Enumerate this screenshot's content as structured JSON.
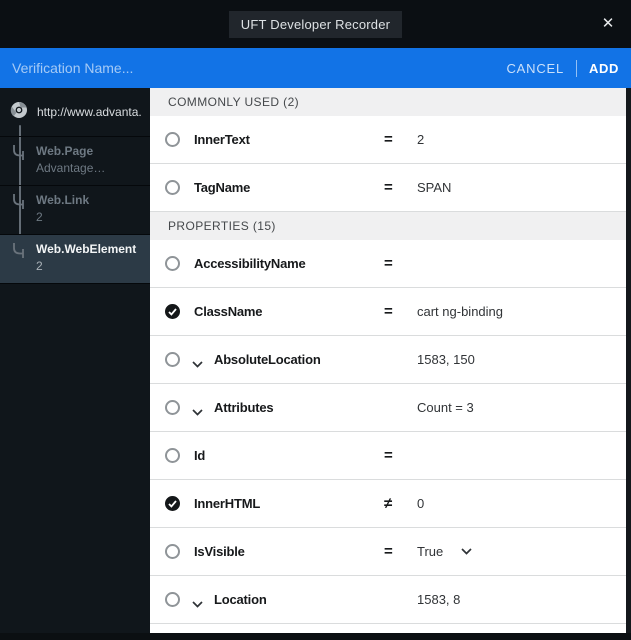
{
  "titlebar": {
    "title": "UFT Developer Recorder",
    "close_glyph": "✕"
  },
  "verification_bar": {
    "placeholder": "Verification Name...",
    "cancel_label": "CANCEL",
    "add_label": "ADD"
  },
  "sidebar": {
    "root_url": "http://www.advanta...",
    "items": [
      {
        "label": "Web.Page",
        "sub": "Advantage…",
        "selected": false
      },
      {
        "label": "Web.Link",
        "sub": "2",
        "selected": false
      },
      {
        "label": "Web.WebElement",
        "sub": "2",
        "selected": true
      }
    ]
  },
  "main": {
    "sections": [
      {
        "header": "COMMONLY USED (2)",
        "rows": [
          {
            "name": "InnerText",
            "checked": false,
            "expandable": false,
            "operator": "=",
            "value": "2",
            "value_dropdown": false
          },
          {
            "name": "TagName",
            "checked": false,
            "expandable": false,
            "operator": "=",
            "value": "SPAN",
            "value_dropdown": false
          }
        ]
      },
      {
        "header": "PROPERTIES (15)",
        "rows": [
          {
            "name": "AccessibilityName",
            "checked": false,
            "expandable": false,
            "operator": "=",
            "value": "",
            "value_dropdown": false
          },
          {
            "name": "ClassName",
            "checked": true,
            "expandable": false,
            "operator": "=",
            "value": "cart ng-binding",
            "value_dropdown": false
          },
          {
            "name": "AbsoluteLocation",
            "checked": false,
            "expandable": true,
            "operator": "",
            "value": "1583, 150",
            "value_dropdown": false
          },
          {
            "name": "Attributes",
            "checked": false,
            "expandable": true,
            "operator": "",
            "value": "Count = 3",
            "value_dropdown": false
          },
          {
            "name": "Id",
            "checked": false,
            "expandable": false,
            "operator": "=",
            "value": "",
            "value_dropdown": false
          },
          {
            "name": "InnerHTML",
            "checked": true,
            "expandable": false,
            "operator": "≠",
            "value": "0",
            "value_dropdown": false
          },
          {
            "name": "IsVisible",
            "checked": false,
            "expandable": false,
            "operator": "=",
            "value": "True",
            "value_dropdown": true
          },
          {
            "name": "Location",
            "checked": false,
            "expandable": true,
            "operator": "",
            "value": "1583, 8",
            "value_dropdown": false
          }
        ]
      }
    ]
  },
  "colors": {
    "accent_blue": "#1273e6",
    "titlebar_bg": "#0b0f13",
    "sidebar_bg": "#10161b",
    "sidebar_selected_bg": "#2c3a46",
    "section_header_bg": "#f0f0f1",
    "checked_circle": "#141719"
  },
  "icons": {
    "close": "close-icon",
    "browser": "chrome-icon",
    "branch": "tree-branch-icon",
    "chevron": "chevron-down-icon",
    "check": "check-icon"
  }
}
